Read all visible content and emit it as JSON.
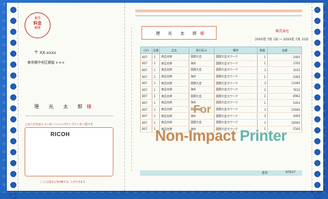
{
  "stub": {
    "stamp_lines": [
      "料金",
      "後納",
      "郵便"
    ],
    "stamp_top": "東京",
    "postal": "〒 XX-xxxx",
    "address": "東京都中央区銀座 x-x-x",
    "name": "理 光 太 郎",
    "honorific": "様",
    "notice": "このハガキはリコーのノンインパクトプリンター用です",
    "logo": "RICOH",
    "footer": "ここに広告などを印刷することができます。"
  },
  "form": {
    "name": "理 光 太 郎",
    "honorific": "様",
    "company": "株式会社",
    "date": "20XX年 7月 1日 ～ 20XX年 7月 31日",
    "headers": [
      "日付",
      "品番",
      "品名",
      "取引区分",
      "備考",
      "数量",
      "金額"
    ],
    "rows": [
      [
        "807",
        "1",
        "商品名称",
        "国際大会",
        "国際大会スワーク",
        "1",
        "2400"
      ],
      [
        "807",
        "1",
        "商品名称",
        "海外",
        "国際大会スワーク",
        "1",
        "1700"
      ],
      [
        "807",
        "1",
        "商品名称",
        "国際大会",
        "国際大会スワーク",
        "3",
        "3410"
      ],
      [
        "807",
        "1",
        "商品名称",
        "海外",
        "国際大会スワーク",
        "1",
        "2400"
      ],
      [
        "807",
        "1",
        "商品名称",
        "国際大会",
        "国際大会スワーク",
        "3",
        "13400"
      ],
      [
        "807",
        "1",
        "商品名称",
        "海外",
        "国際大会スワーク",
        "2",
        "7610"
      ],
      [
        "807",
        "1",
        "商品名称",
        "国際大会",
        "国際大会スワーク",
        "1",
        "6962"
      ],
      [
        "807",
        "1",
        "商品名称",
        "海外",
        "国際大会スワーク",
        "1",
        "5454"
      ],
      [
        "807",
        "1",
        "商品名称",
        "国際大会",
        "国際大会スワーク",
        "3",
        "15600"
      ],
      [
        "807",
        "1",
        "商品名称",
        "海外",
        "国際大会スワーク",
        "2",
        "4400"
      ],
      [
        "807",
        "1",
        "商品名称",
        "国際大会",
        "国際大会スワーク",
        "3",
        "10600"
      ],
      [
        "807",
        "1",
        "商品名称",
        "海外",
        "国際大会スワーク",
        "1",
        "5500"
      ]
    ],
    "total_label": "合計",
    "total_value": "87617"
  },
  "overlay": {
    "for": "For",
    "line1": "Non-Impact",
    "line2": "Printer"
  }
}
